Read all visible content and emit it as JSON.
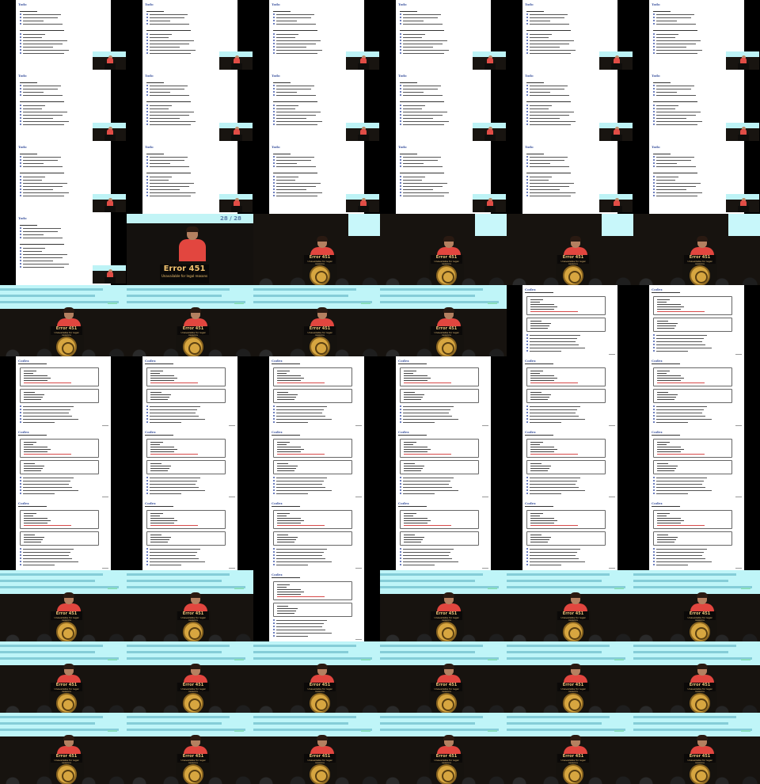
{
  "slide_title_todo": "Todo",
  "slide_title_code": "Codex",
  "podium_sign": "Error 451",
  "podium_subtitle": "Unavailable for legal reasons",
  "slide_counter": "28 / 28",
  "grid_layout": [
    [
      "todo",
      "todo",
      "todo",
      "todo",
      "todo",
      "todo"
    ],
    [
      "todo",
      "todo",
      "todo",
      "todo",
      "todo",
      "todo"
    ],
    [
      "todo",
      "todo",
      "todo",
      "todo",
      "todo",
      "todo"
    ],
    [
      "todo",
      "stage_big",
      "stage",
      "stage",
      "stage",
      "stage"
    ],
    [
      "stage_screen",
      "stage_screen",
      "stage_screen",
      "stage_screen",
      "code",
      "code"
    ],
    [
      "code",
      "code",
      "code",
      "code",
      "code",
      "code"
    ],
    [
      "code",
      "code",
      "code",
      "code",
      "code",
      "code"
    ],
    [
      "code",
      "code",
      "code",
      "code",
      "code",
      "code"
    ],
    [
      "stage_screen",
      "stage_screen",
      "code",
      "stage_screen",
      "stage_screen",
      "stage_screen"
    ],
    [
      "stage_screen",
      "stage_screen",
      "stage_screen",
      "stage_screen",
      "stage_screen",
      "stage_screen"
    ],
    [
      "stage_screen",
      "stage_screen",
      "stage_screen",
      "stage_screen",
      "stage_screen",
      "stage_screen"
    ]
  ]
}
